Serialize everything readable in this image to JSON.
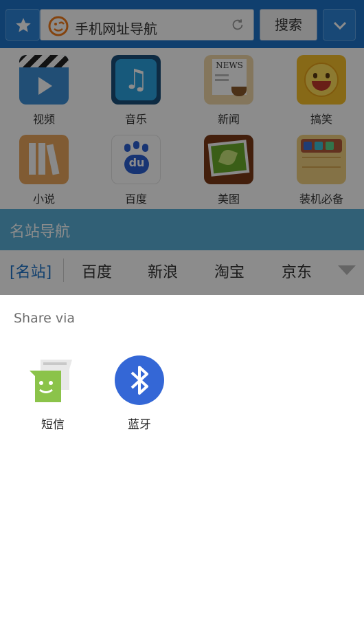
{
  "browser": {
    "url_title": "手机网址导航",
    "search_label": "搜索",
    "tiles": [
      {
        "label": "视频"
      },
      {
        "label": "音乐"
      },
      {
        "label": "新闻"
      },
      {
        "label": "搞笑"
      },
      {
        "label": "小说"
      },
      {
        "label": "百度"
      },
      {
        "label": "美图"
      },
      {
        "label": "装机必备"
      }
    ],
    "news_icon_text": "NEWS",
    "baidu_icon_text": "du",
    "famous_sites": {
      "title": "名站导航",
      "tag": "[名站]",
      "links": [
        "百度",
        "新浪",
        "淘宝",
        "京东"
      ]
    }
  },
  "share_sheet": {
    "title": "Share via",
    "targets": [
      {
        "label": "短信",
        "icon": "messaging-icon"
      },
      {
        "label": "蓝牙",
        "icon": "bluetooth-icon"
      }
    ]
  },
  "colors": {
    "toolbar_blue": "#1e73c8",
    "section_bar": "#5ab0d8",
    "scrim": "rgba(0,0,0,0.45)",
    "bluetooth_blue": "#3467d6",
    "messaging_green": "#8bc34a"
  }
}
